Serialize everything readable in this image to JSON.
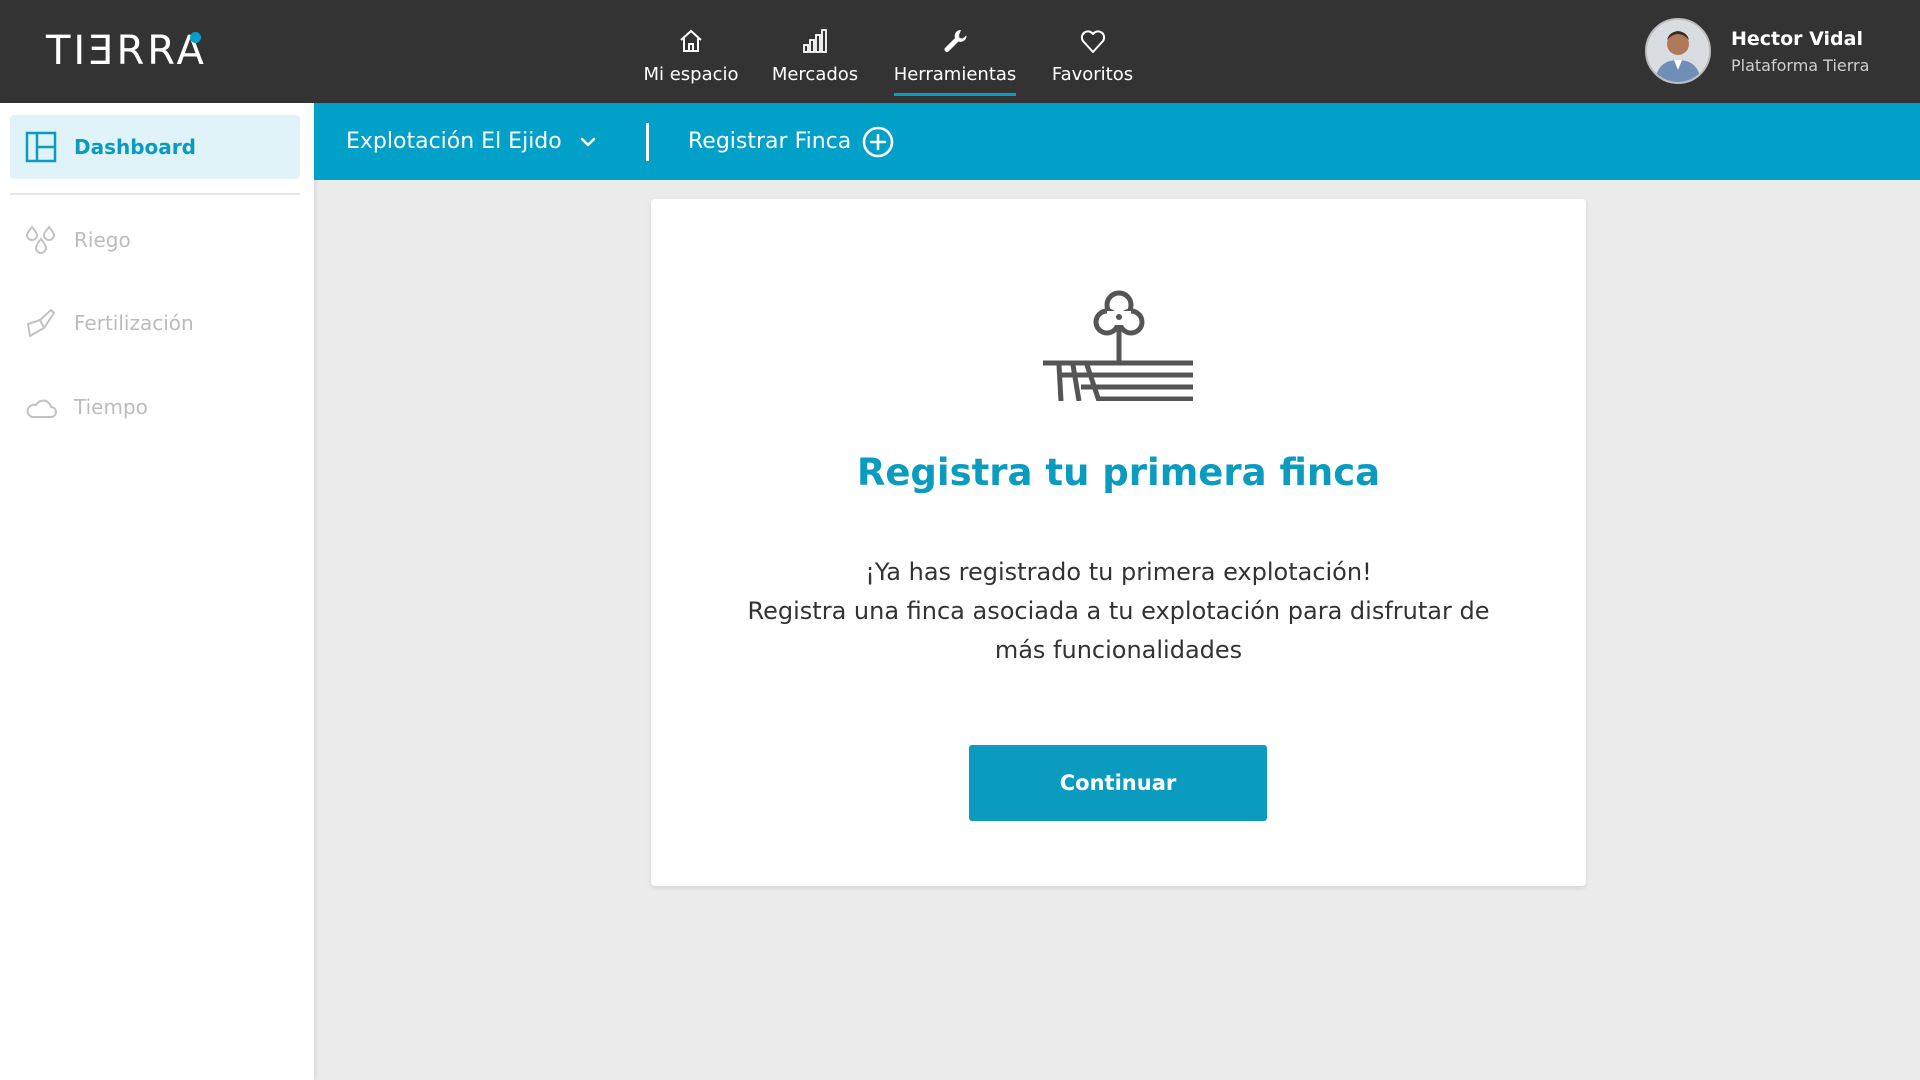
{
  "app": {
    "logo": "TIƎRRA"
  },
  "topnav": {
    "items": [
      {
        "label": "Mi espacio",
        "icon": "home-icon"
      },
      {
        "label": "Mercados",
        "icon": "bar-chart-icon"
      },
      {
        "label": "Herramientas",
        "icon": "wrench-icon",
        "active": true
      },
      {
        "label": "Favoritos",
        "icon": "heart-icon"
      }
    ]
  },
  "user": {
    "name": "Hector Vidal",
    "subtitle": "Plataforma Tierra"
  },
  "sidebar": {
    "items": [
      {
        "label": "Dashboard",
        "icon": "dashboard-icon",
        "active": true
      },
      {
        "label": "Riego",
        "icon": "water-drops-icon"
      },
      {
        "label": "Fertilización",
        "icon": "fertilizer-icon"
      },
      {
        "label": "Tiempo",
        "icon": "cloud-icon"
      }
    ]
  },
  "subbar": {
    "farm_selector": "Explotación El Ejido",
    "register_label": "Registrar Finca"
  },
  "card": {
    "title": "Registra tu primera finca",
    "lines": [
      "¡Ya has registrado tu primera explotación!",
      "Registra una finca asociada a tu explotación para disfrutar de",
      "más funcionalidades"
    ],
    "button_label": "Continuar"
  },
  "colors": {
    "header_bg": "#333333",
    "accent": "#00a0c8",
    "accent_text": "#0a9bbf",
    "sidebar_active_bg": "#dff3f8",
    "sidebar_inactive_text": "#bcbcbc",
    "content_bg": "#ececec"
  }
}
